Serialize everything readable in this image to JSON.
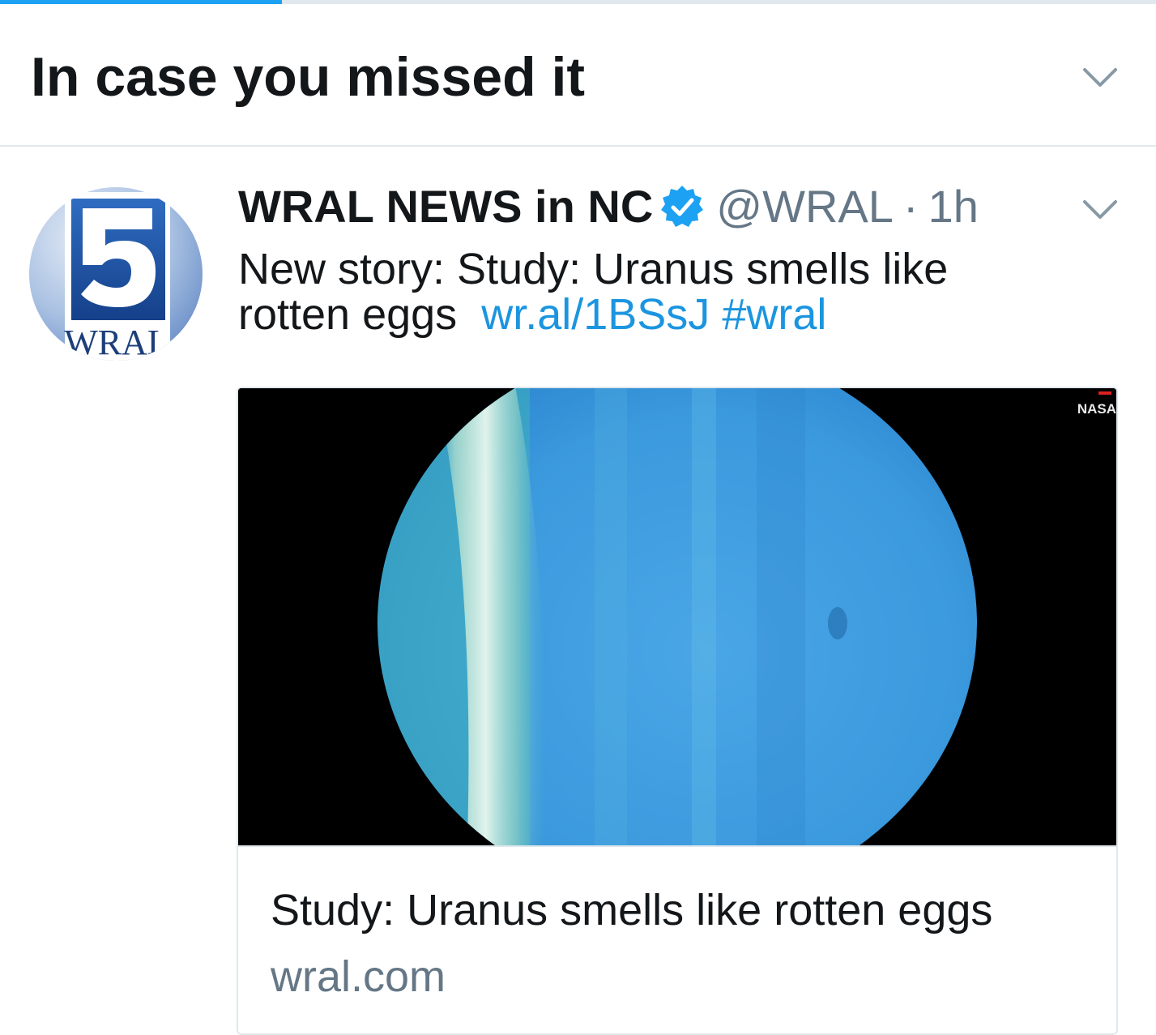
{
  "progress": {
    "fraction": 0.244,
    "color": "#1da1f2"
  },
  "section": {
    "title": "In case you missed it",
    "menu_icon": "chevron-down-icon"
  },
  "tweet": {
    "author": {
      "name": "WRAL NEWS in NC",
      "verified": true,
      "handle": "@WRAL",
      "avatar_text": "WRAL",
      "avatar_number": "5"
    },
    "separator": "·",
    "time": "1h",
    "text_line1": "New story: Study: Uranus smells like",
    "text_line2": "rotten eggs",
    "link": "wr.al/1BSsJ",
    "hashtag": "#wral",
    "menu_icon": "chevron-down-icon",
    "card": {
      "image_watermark": "NASA",
      "title": "Study: Uranus smells like rotten eggs",
      "domain": "wral.com"
    }
  },
  "colors": {
    "text_primary": "#14171a",
    "text_secondary": "#657786",
    "link": "#1b95e0",
    "border": "#e1e8ed",
    "verified": "#1da1f2"
  }
}
